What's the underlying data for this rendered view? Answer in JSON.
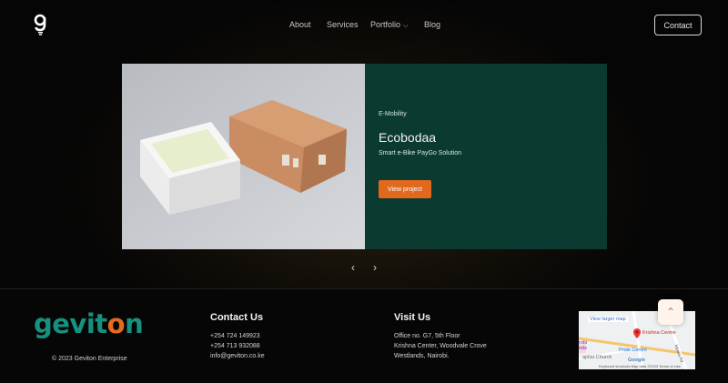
{
  "header": {
    "nav": {
      "about": "About",
      "services": "Services",
      "portfolio": "Portfolio",
      "blog": "Blog"
    },
    "contact_label": "Contact"
  },
  "slide": {
    "category": "E-Mobility",
    "title": "Ecobodaa",
    "subtitle": "Smart e-Bike PayGo Solution",
    "cta_label": "View project",
    "panel_color": "#0a3a30",
    "cta_color": "#e1681d"
  },
  "footer": {
    "brand": {
      "part1": "gevit",
      "o": "o",
      "part2": "n"
    },
    "copyright": "© 2023 Geviton Enterprise",
    "contact": {
      "title": "Contact Us",
      "phone1": "+254 724 149923",
      "phone2": "+254 713 932088",
      "email": "info@geviton.co.ke"
    },
    "visit": {
      "title": "Visit Us",
      "line1": "Office no. G7, 5th Floor",
      "line2": "Krishna Center, Woodvale Crove",
      "line3": "Westlands, Nairobi."
    },
    "map": {
      "link": "View larger map",
      "pin_label": "Krishna Centre",
      "place1": "Pride Centre",
      "place2": "aptist Church",
      "place3": "robi",
      "place4": "nds",
      "road": "Mpaka Rd",
      "footer": "Keyboard shortcuts   Map data ©2023   Terms of Use",
      "google": "Google"
    }
  }
}
